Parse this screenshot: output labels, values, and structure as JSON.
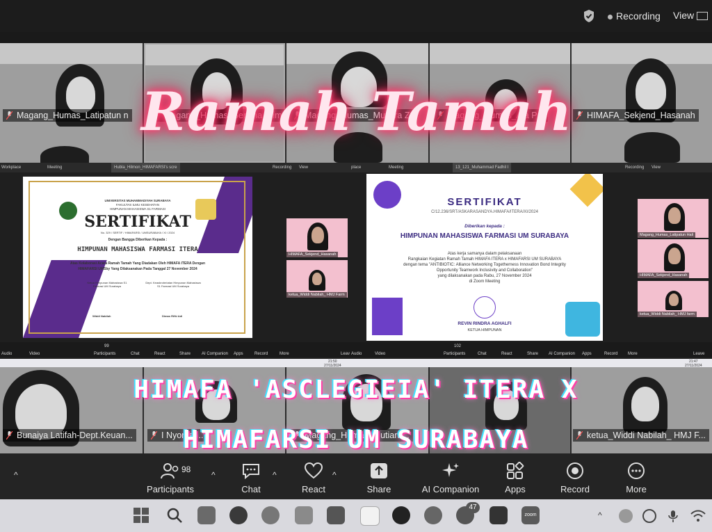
{
  "topbar": {
    "recording_label": "Recording",
    "view_label": "View"
  },
  "overlay": {
    "title": "Ramah Tamah",
    "subtitle_line1": "HIMAFA 'ASCLEGIEIA' ITERA X",
    "subtitle_line2": "HIMAFARSI UM SURABAYA"
  },
  "participants_top": [
    {
      "name": "Magang_Humas_Latipatun n"
    },
    {
      "name": "Magang_Humas_Sentina_Sima"
    },
    {
      "name": "Magang_Humas_Mutiara Z"
    },
    {
      "name": "Magang_Humas_Ala Put"
    },
    {
      "name": "HIMAFA_Sekjend_Hasanah"
    }
  ],
  "participants_bottom": [
    {
      "name": "Bunaiya Latifah-Dept.Keuan..."
    },
    {
      "name": "I Nyoman..."
    },
    {
      "name": "Magang_Humas_Mutiara..."
    },
    {
      "name": "ketua_Widdi Nabilah_ HMJ F..."
    }
  ],
  "screenshot_left": {
    "app": "Workplace",
    "meeting_label": "Meeting",
    "speaker_tab": "Hubla_Hilmon_HIMAFARSI's scre",
    "recording_label": "Recording",
    "view_label": "View",
    "cert_uni": "UNIVERSITAS MUHAMMADIYAH SURABAYA",
    "cert_faculty": "FAKULTAS ILMU KESEHATAN",
    "cert_assoc": "HIMPUNAN MAHASISWA S1 FARMASI",
    "cert_title": "SERTIFIKAT",
    "cert_number": "No. 329 / SERTIF / HIMAFARSI / UMSURABAYA / XI / 2024",
    "cert_given": "Dengan Bangga Diberikan Kepada :",
    "cert_recipient": "HIMPUNAN MAHASISWA FARMASI ITERA",
    "cert_body1": "Atas Kolaborasi Acara Ramah Tamah Yang Diadakan Oleh HIMAFA ITERA Dengan",
    "cert_body2": "HIMAFARSI UMSby Yang Dilaksanakan Pada Tanggal 27 November 2024",
    "sign1_role": "Ketua Himpunan Mahasiswa S1 Farmasi UM Surabaya",
    "sign1_name": "Widdi Nabilah",
    "sign2_role": "Dept. Keasbroteriatan Himpunan Mahasiswa S1 Farmasi UM Surabaya",
    "sign2_name": "Dimas Rifki Adi",
    "cam1": "HIMAFA_Sekjend_Hasanah",
    "cam2": "ketua_Widdi Nabilah_ HMJ Farm",
    "controls": [
      "Audio",
      "Video",
      "Participants",
      "Chat",
      "React",
      "Share",
      "AI Companion",
      "Apps",
      "Record",
      "More",
      "Leave"
    ],
    "participants_count": "99",
    "time": "21:50",
    "date": "27/11/2024"
  },
  "screenshot_right": {
    "app": "place",
    "meeting_label": "Meeting",
    "speaker_tab": "13_121_Muhammad Fadhil I",
    "recording_label": "Recording",
    "view_label": "View",
    "cert_title": "SERTIFIKAT",
    "cert_number": "C/12.236/SRT/ASKARASANDYA.HIMAFA/ITERA/XI/2024",
    "cert_given": "Diberikan kepada :",
    "cert_recipient": "HIMPUNAN MAHASISWA FARMASI UM SURABAYA",
    "cert_body1": "Atas kerja samanya dalam pelaksanaan",
    "cert_body2": "Rangkaian Kegiatan Ramah Tamah HIMAFA ITERA x HIMAFARSI UM SURABAYA",
    "cert_body3": "dengan tema \"ANTIBIOTIC: Alliance Networking Togetherness Innovation Bond Integrity",
    "cert_body4": "Opportunity Teamwork Inclusivity and Collaboration\"",
    "cert_body5": "yang dilaksanakan pada Rabu, 27 November 2024",
    "cert_body6": "di Zoom Meeting",
    "sign_name": "REVIN RINDRA AGHALFI",
    "sign_role": "KETUA HIMPUNAN",
    "cam1": "Magang_Humas_Latipatun Hali",
    "cam2": "HIMAFA_Sekjend_Hasanah",
    "cam3": "ketua_Widdi Nabilah_ HMJ farm",
    "participants_count": "102",
    "time": "21:47",
    "date": "27/11/2024"
  },
  "controls": {
    "participants_label": "Participants",
    "participants_count": "98",
    "chat_label": "Chat",
    "react_label": "React",
    "share_label": "Share",
    "ai_label": "AI Companion",
    "apps_label": "Apps",
    "record_label": "Record",
    "more_label": "More"
  },
  "taskbar": {
    "whatsapp_badge": "47",
    "zoom_label": "zoom"
  }
}
